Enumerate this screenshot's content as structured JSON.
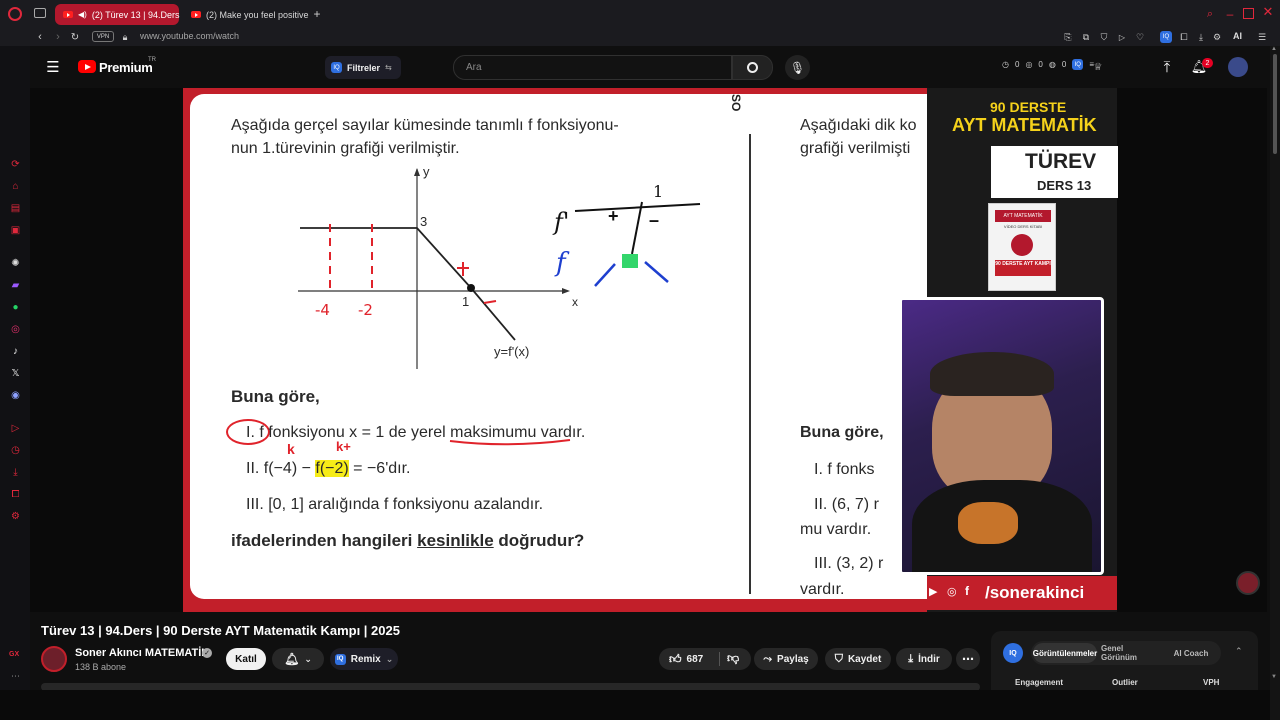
{
  "browser": {
    "tabs": [
      {
        "label": "(2) Türev 13 | 94.Ders",
        "active": true
      },
      {
        "label": "(2) Make you feel positive",
        "active": false
      }
    ],
    "vpn_label": "VPN",
    "url": "www.youtube.com/watch",
    "ai_label": "AI"
  },
  "masthead": {
    "logo_text": "Premium",
    "logo_sup": "TR",
    "filter_label": "Filtreler",
    "search_placeholder": "Ara",
    "stats": [
      "0",
      "0",
      "0"
    ],
    "notif_count": "2",
    "iq_badge": "IQ"
  },
  "video": {
    "sheet": {
      "question_line1": "Aşağıda gerçel sayılar kümesinde tanımlı f fonksiyonu-",
      "question_line2": "nun 1.türevinin grafiği verilmiştir.",
      "graph": {
        "y_axis": "y",
        "x_axis": "x",
        "y_tick": "3",
        "x_tick": "1",
        "curve_label": "y=f'(x)",
        "hand_marks": [
          "-4",
          "-2"
        ]
      },
      "sign_chart": {
        "top": "1",
        "row1": "f'",
        "plus": "+",
        "minus": "–",
        "row2": "f"
      },
      "buna_gore": "Buna göre,",
      "items": [
        {
          "num": "I.",
          "text": "f fonksiyonu  x = 1 de yerel maksimumu vardır."
        },
        {
          "num": "II.",
          "text_pre": "f(−4) − ",
          "highlight": "f(−2)",
          "text_post": " = −6'dır."
        },
        {
          "num": "III.",
          "text": "[0, 1] aralığında f fonksiyonu azalandır."
        }
      ],
      "final_pre": "ifadelerinden hangileri ",
      "final_underline": "kesinlikle",
      "final_post": " doğrudur?",
      "side_label": "SO"
    },
    "right_sheet": {
      "line1": "Aşağıdaki dik ko",
      "line2": "grafiği verilmişti",
      "buna_gore": "Buna göre,",
      "items": [
        "I.   f fonks",
        "II.  (6, 7) r",
        "mu vardır.",
        "III. (3, 2) r",
        "vardır."
      ]
    },
    "branding": {
      "top1": "90 DERSTE",
      "top2": "AYT MATEMATİK",
      "turev": "TÜREV",
      "ders": "DERS 13",
      "book_title": "AYT MATEMATİK",
      "book_sub": "VİDEO DERS KİTABI",
      "book_badge": "90 DERSTE AYT KAMPI",
      "social_handle": "/sonerakinci"
    }
  },
  "below": {
    "title": "Türev 13 | 94.Ders | 90 Derste AYT Matematik Kampı | 2025",
    "channel_name": "Soner Akıncı MATEMATİK",
    "subscribers": "138 B abone",
    "join_label": "Katıl",
    "remix_label": "Remix",
    "likes": "687",
    "share_label": "Paylaş",
    "save_label": "Kaydet",
    "download_label": "İndir",
    "iq_tabs": [
      "Görüntülenmeler",
      "Genel Görünüm",
      "AI Coach"
    ],
    "iq_columns": [
      "Engagement",
      "Outlier",
      "VPH"
    ],
    "gx_label": "GX"
  },
  "colors": {
    "accent": "#ff0000",
    "opera_red": "#b3182d",
    "highlight": "#f6ec18",
    "brand_red": "#c21f2a"
  }
}
